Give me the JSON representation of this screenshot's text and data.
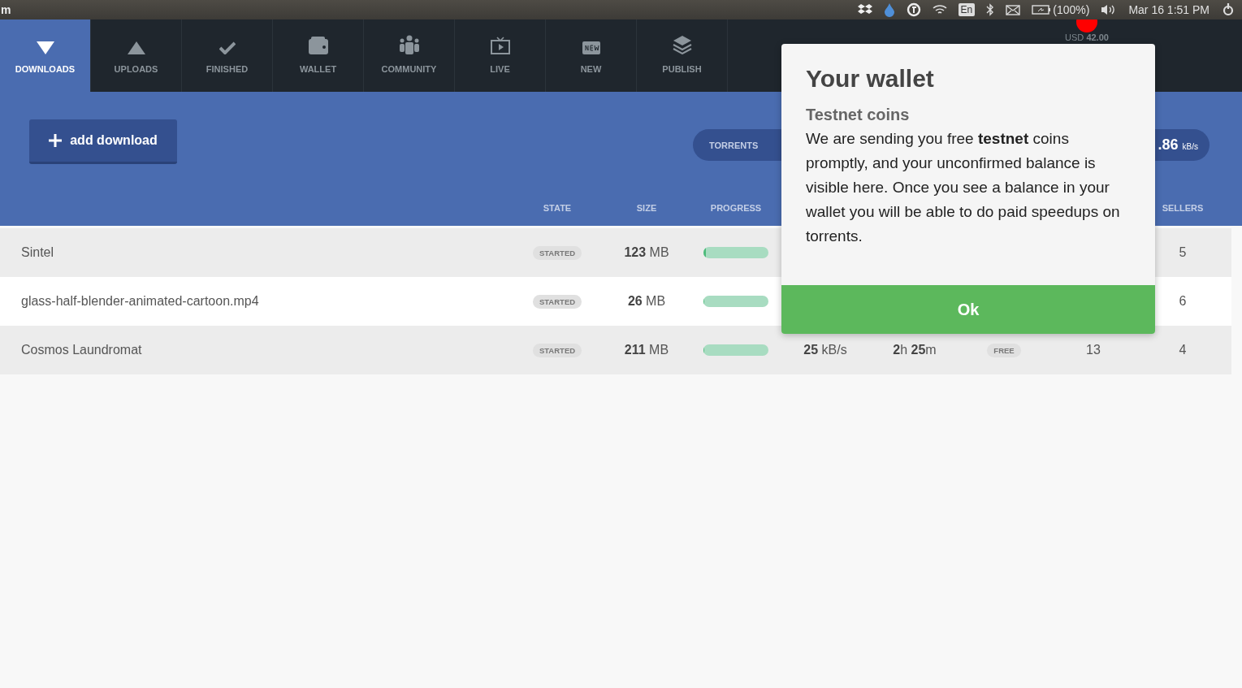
{
  "system_bar": {
    "app": "m",
    "keyboard": "En",
    "battery": "(100%)",
    "clock": "Mar 16  1:51 PM"
  },
  "balance": {
    "label": "USD",
    "amount": "42.00"
  },
  "tabs": [
    {
      "label": "DOWNLOADS",
      "selected": true
    },
    {
      "label": "UPLOADS",
      "selected": false
    },
    {
      "label": "FINISHED",
      "selected": false
    },
    {
      "label": "WALLET",
      "selected": false
    },
    {
      "label": "COMMUNITY",
      "selected": false
    },
    {
      "label": "LIVE",
      "selected": false
    },
    {
      "label": "NEW",
      "selected": false
    },
    {
      "label": "PUBLISH",
      "selected": false
    }
  ],
  "add_button": "add download",
  "stats_pill": {
    "label": "TORRENTS",
    "speed": ".86",
    "unit": "kB/s"
  },
  "table": {
    "columns": [
      {
        "label": "STATE"
      },
      {
        "label": "SIZE"
      },
      {
        "label": "PROGRESS"
      },
      null,
      null,
      null,
      null,
      {
        "label": "SELLERS"
      }
    ],
    "rows": [
      {
        "name": "Sintel",
        "state": "STARTED",
        "size": "**123** MB",
        "level": 0.04,
        "sellers": "5"
      },
      {
        "name": "glass-half-blender-animated-cartoon.mp4",
        "state": "STARTED",
        "size": "**26** MB",
        "level": 0.01,
        "sellers": "6"
      },
      {
        "name": "Cosmos Laundromat",
        "state": "STARTED",
        "size": "**211** MB",
        "level": 0.01,
        "speed": "**25** kB/s",
        "time": "**2**h **25**m",
        "price": "FREE",
        "buyers": "13",
        "sellers": "4"
      }
    ]
  },
  "modal": {
    "title": "Your wallet",
    "subtitle": "Testnet coins",
    "body": "We are sending you free **testnet** coins promptly, and your unconfirmed balance is visible here. Once you see a balance in your wallet you will be able to do paid speedups on torrents.",
    "button": "Ok"
  }
}
